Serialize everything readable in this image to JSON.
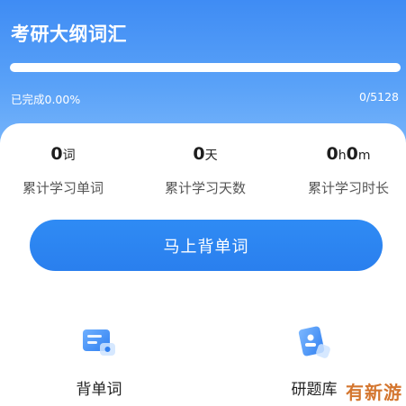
{
  "header": {
    "title": "考研大纲词汇",
    "progress_text": "已完成0.00%",
    "progress_fraction": 0.0,
    "progress_count": "0/5128"
  },
  "stats": [
    {
      "value": "0",
      "unit": "词",
      "label": "累计学习单词"
    },
    {
      "value": "0",
      "unit": "天",
      "label": "累计学习天数"
    },
    {
      "value_parts": [
        "0",
        "h",
        "0",
        "m"
      ],
      "label": "累计学习时长"
    }
  ],
  "start_button": {
    "label": "马上背单词"
  },
  "features": [
    {
      "label": "背单词",
      "icon": "flashcard-icon"
    },
    {
      "label": "研题库",
      "icon": "question-bank-icon"
    }
  ],
  "watermark": "有新游",
  "colors": {
    "header_top": "#3f8cf4",
    "header_bottom": "#7cb8fb",
    "accent_button": "#2f8bf4",
    "watermark": "#d4762f"
  }
}
